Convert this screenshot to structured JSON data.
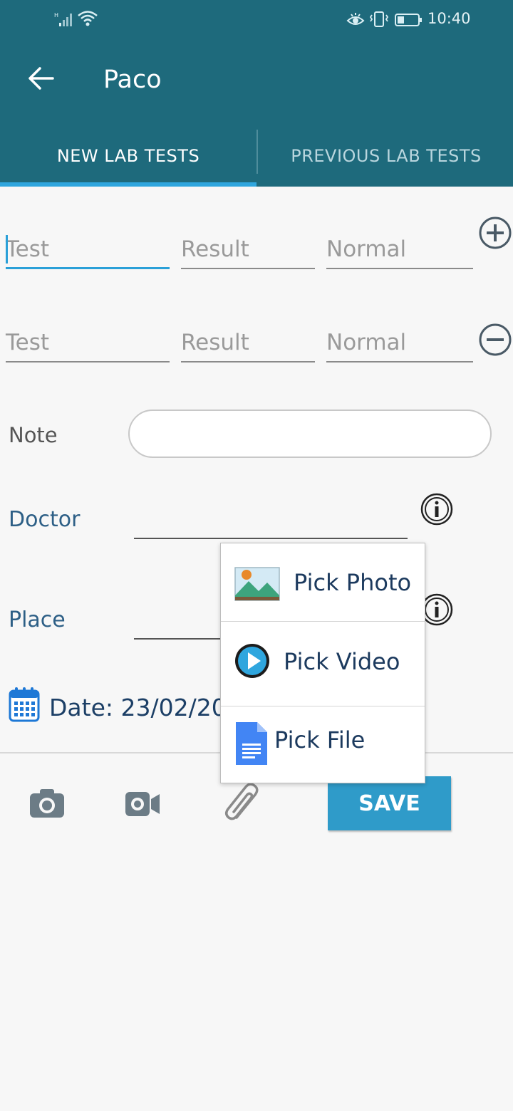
{
  "status_bar": {
    "signal_icon": "signal-icon",
    "wifi_icon": "wifi-icon",
    "eye_icon": "eye-comfort-icon",
    "vibrate_icon": "vibrate-icon",
    "battery_icon": "battery-icon",
    "time": "10:40"
  },
  "header": {
    "back_icon": "back-arrow-icon",
    "title": "Paco"
  },
  "tabs": [
    {
      "label": "NEW LAB TESTS",
      "selected": true
    },
    {
      "label": "PREVIOUS LAB TESTS",
      "selected": false
    }
  ],
  "test_rows": [
    {
      "test_placeholder": "Test",
      "result_placeholder": "Result",
      "normal_placeholder": "Normal",
      "action_icon": "add-circle-icon"
    },
    {
      "test_placeholder": "Test",
      "result_placeholder": "Result",
      "normal_placeholder": "Normal",
      "action_icon": "remove-circle-icon"
    }
  ],
  "note": {
    "label": "Note",
    "value": ""
  },
  "doctor": {
    "label": "Doctor",
    "value": ""
  },
  "place": {
    "label": "Place",
    "value": ""
  },
  "date": {
    "text": "Date: 23/02/20"
  },
  "toolbar": {
    "camera_icon": "camera-icon",
    "video_icon": "video-camera-icon",
    "attach_icon": "paperclip-icon",
    "save_label": "SAVE"
  },
  "attach_menu": {
    "items": [
      {
        "label": "Pick Photo",
        "icon": "photo-icon"
      },
      {
        "label": "Pick Video",
        "icon": "play-icon"
      },
      {
        "label": "Pick File",
        "icon": "document-icon"
      }
    ]
  },
  "colors": {
    "appbar": "#1e6a7c",
    "tab_indicator": "#2fa6de",
    "accent_blue": "#2f9bc9",
    "label_blue": "#2d5f86"
  }
}
